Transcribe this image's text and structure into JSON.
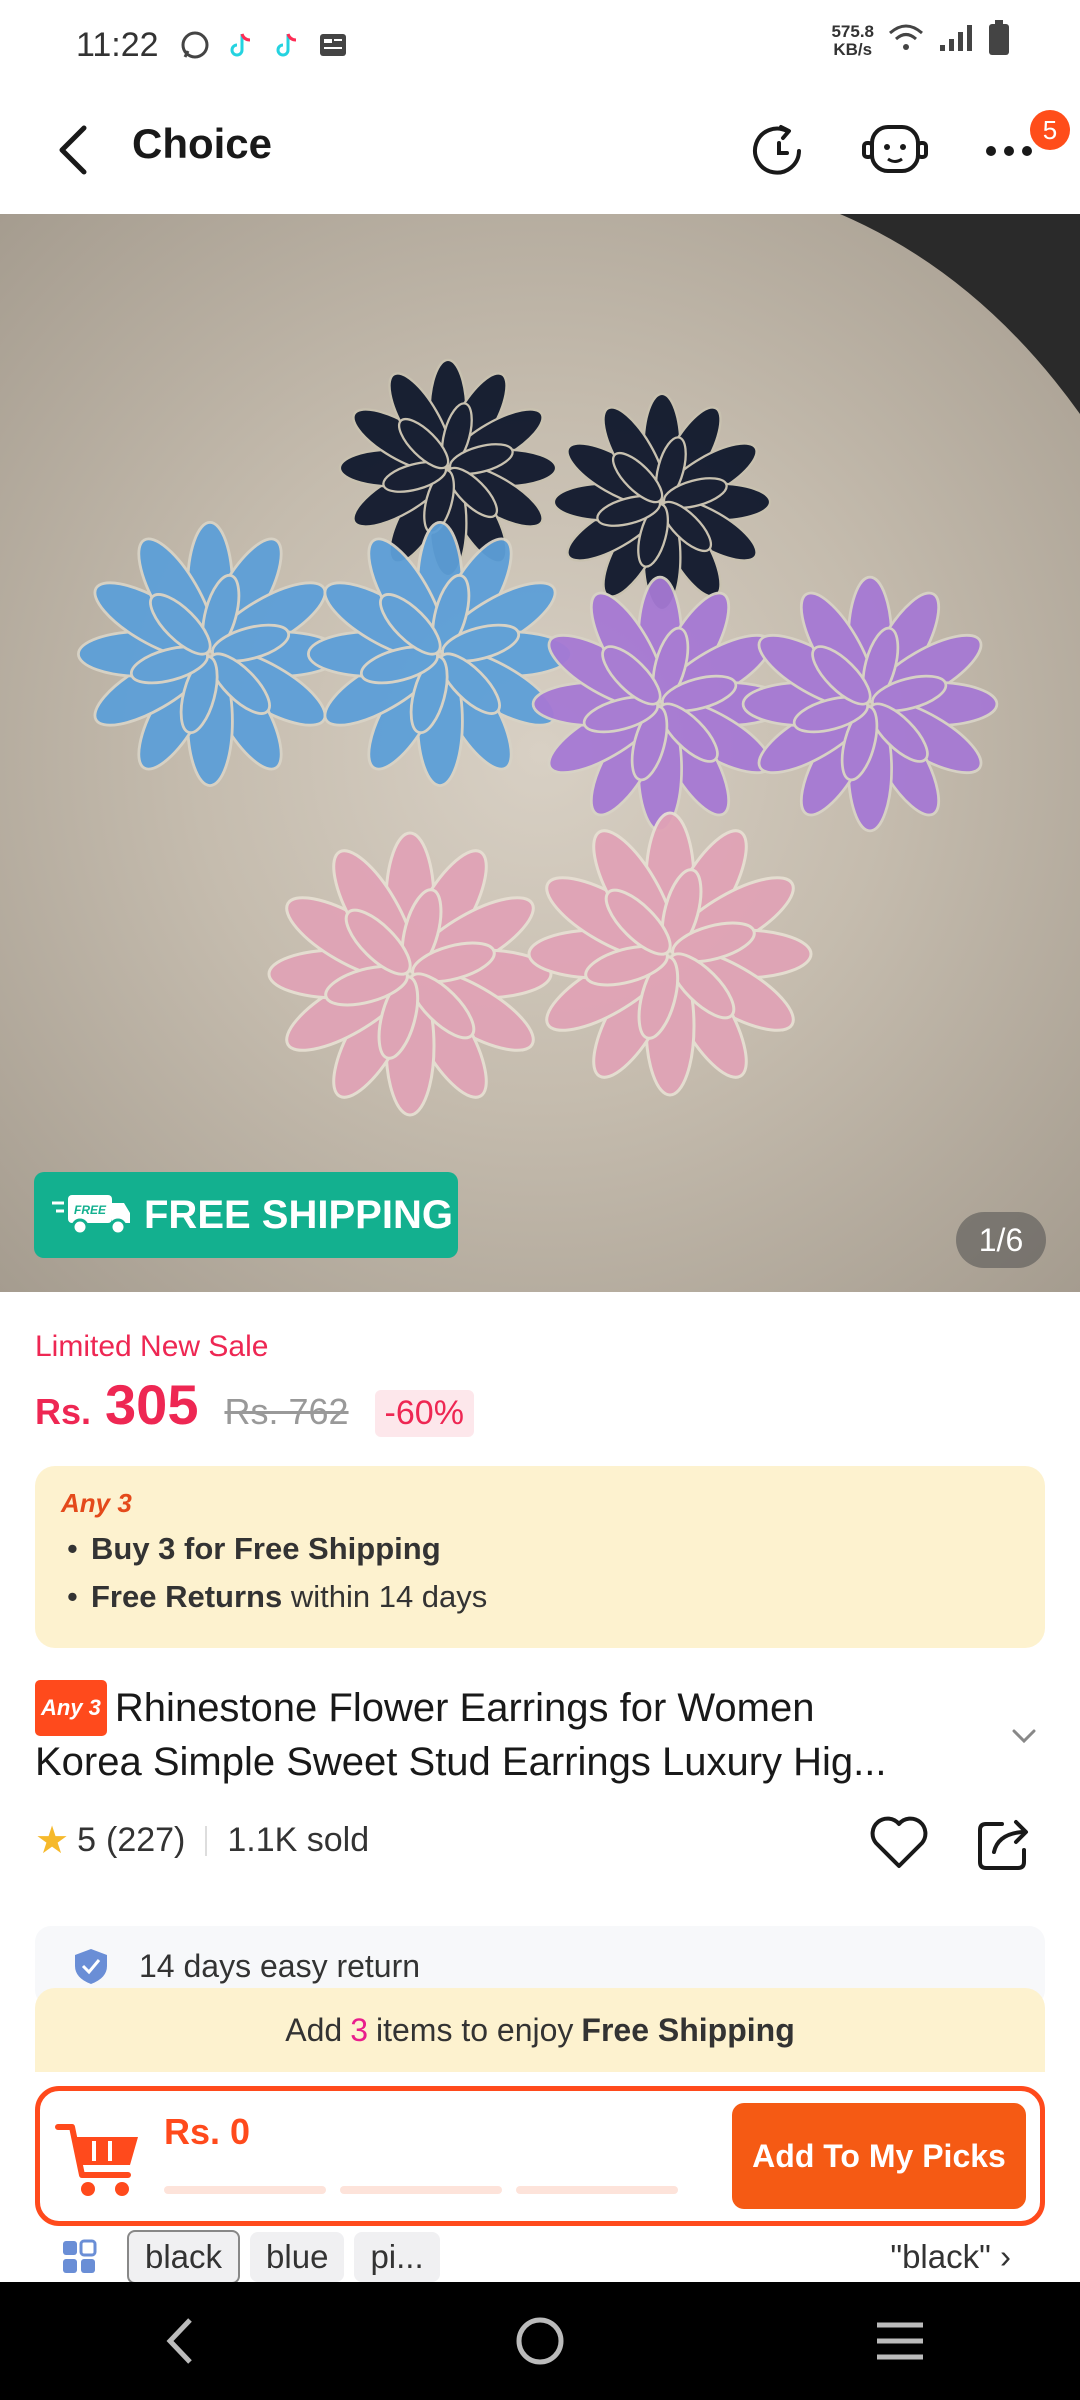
{
  "status_bar": {
    "time": "11:22",
    "net_speed_value": "575.8",
    "net_speed_unit": "KB/s"
  },
  "nav": {
    "title": "Choice",
    "badge_count": "5"
  },
  "gallery": {
    "free_shipping_label": "FREE SHIPPING",
    "free_truck_text": "FREE",
    "counter": "1/6"
  },
  "price": {
    "sale_label": "Limited New Sale",
    "currency": "Rs.",
    "current": "305",
    "original": "Rs. 762",
    "discount": "-60%"
  },
  "promo": {
    "tag": "Any 3",
    "line1_bold": "Buy 3 for  Free Shipping",
    "line2_bold": "Free Returns",
    "line2_rest": " within 14 days"
  },
  "product": {
    "tag": "Any 3",
    "title_line1": "Rhinestone Flower Earrings for Women",
    "title_line2": "Korea Simple Sweet Stud Earrings Luxury Hig..."
  },
  "rating": {
    "score": "5",
    "count": "(227)",
    "sold": "1.1K sold"
  },
  "service": {
    "return_text": "14 days easy return"
  },
  "shipping_banner": {
    "prefix": "Add",
    "count": "3",
    "middle": "items to enjoy",
    "bold": "Free Shipping"
  },
  "cart_bar": {
    "amount": "Rs. 0",
    "button_label": "Add To My Picks"
  },
  "sku": {
    "chips": [
      "black",
      "blue",
      "pi..."
    ],
    "selected": "\"black\""
  },
  "colors": {
    "accent": "#ff4a1c",
    "price_red": "#ee2753",
    "free_ship_green": "#13b08f",
    "promo_bg": "#fdf2cf"
  }
}
